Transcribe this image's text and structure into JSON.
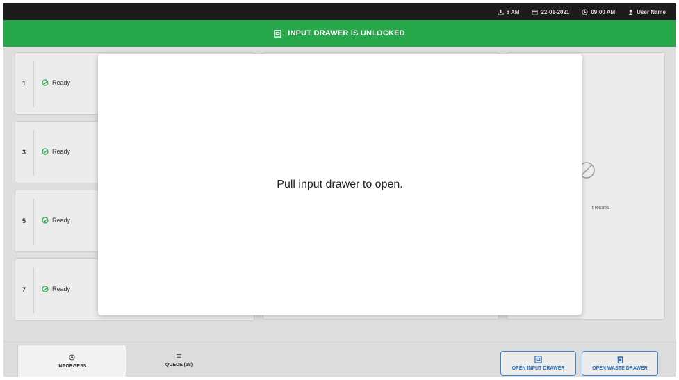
{
  "topbar": {
    "status": "8 AM",
    "date": "22-01-2021",
    "time": "09:00 AM",
    "user": "User Name"
  },
  "banner": {
    "message": "INPUT DRAWER IS UNLOCKED",
    "color": "#27a84a"
  },
  "slots": [
    {
      "number": "1",
      "status": "Ready"
    },
    {
      "number": "3",
      "status": "Ready"
    },
    {
      "number": "5",
      "status": "Ready"
    },
    {
      "number": "7",
      "status": "Ready"
    }
  ],
  "right_panel": {
    "message": "t resutls."
  },
  "modal": {
    "message": "Pull input drawer to open."
  },
  "bottom": {
    "tabs": [
      {
        "label": "INPORGESS",
        "icon": "target-icon"
      },
      {
        "label": "QUEUE (18)",
        "icon": "list-icon"
      }
    ],
    "buttons": {
      "open_input": "OPEN INPUT DRAWER",
      "open_waste": "OPEN WASTE DRAWER"
    },
    "accent": "#3a86d6"
  }
}
